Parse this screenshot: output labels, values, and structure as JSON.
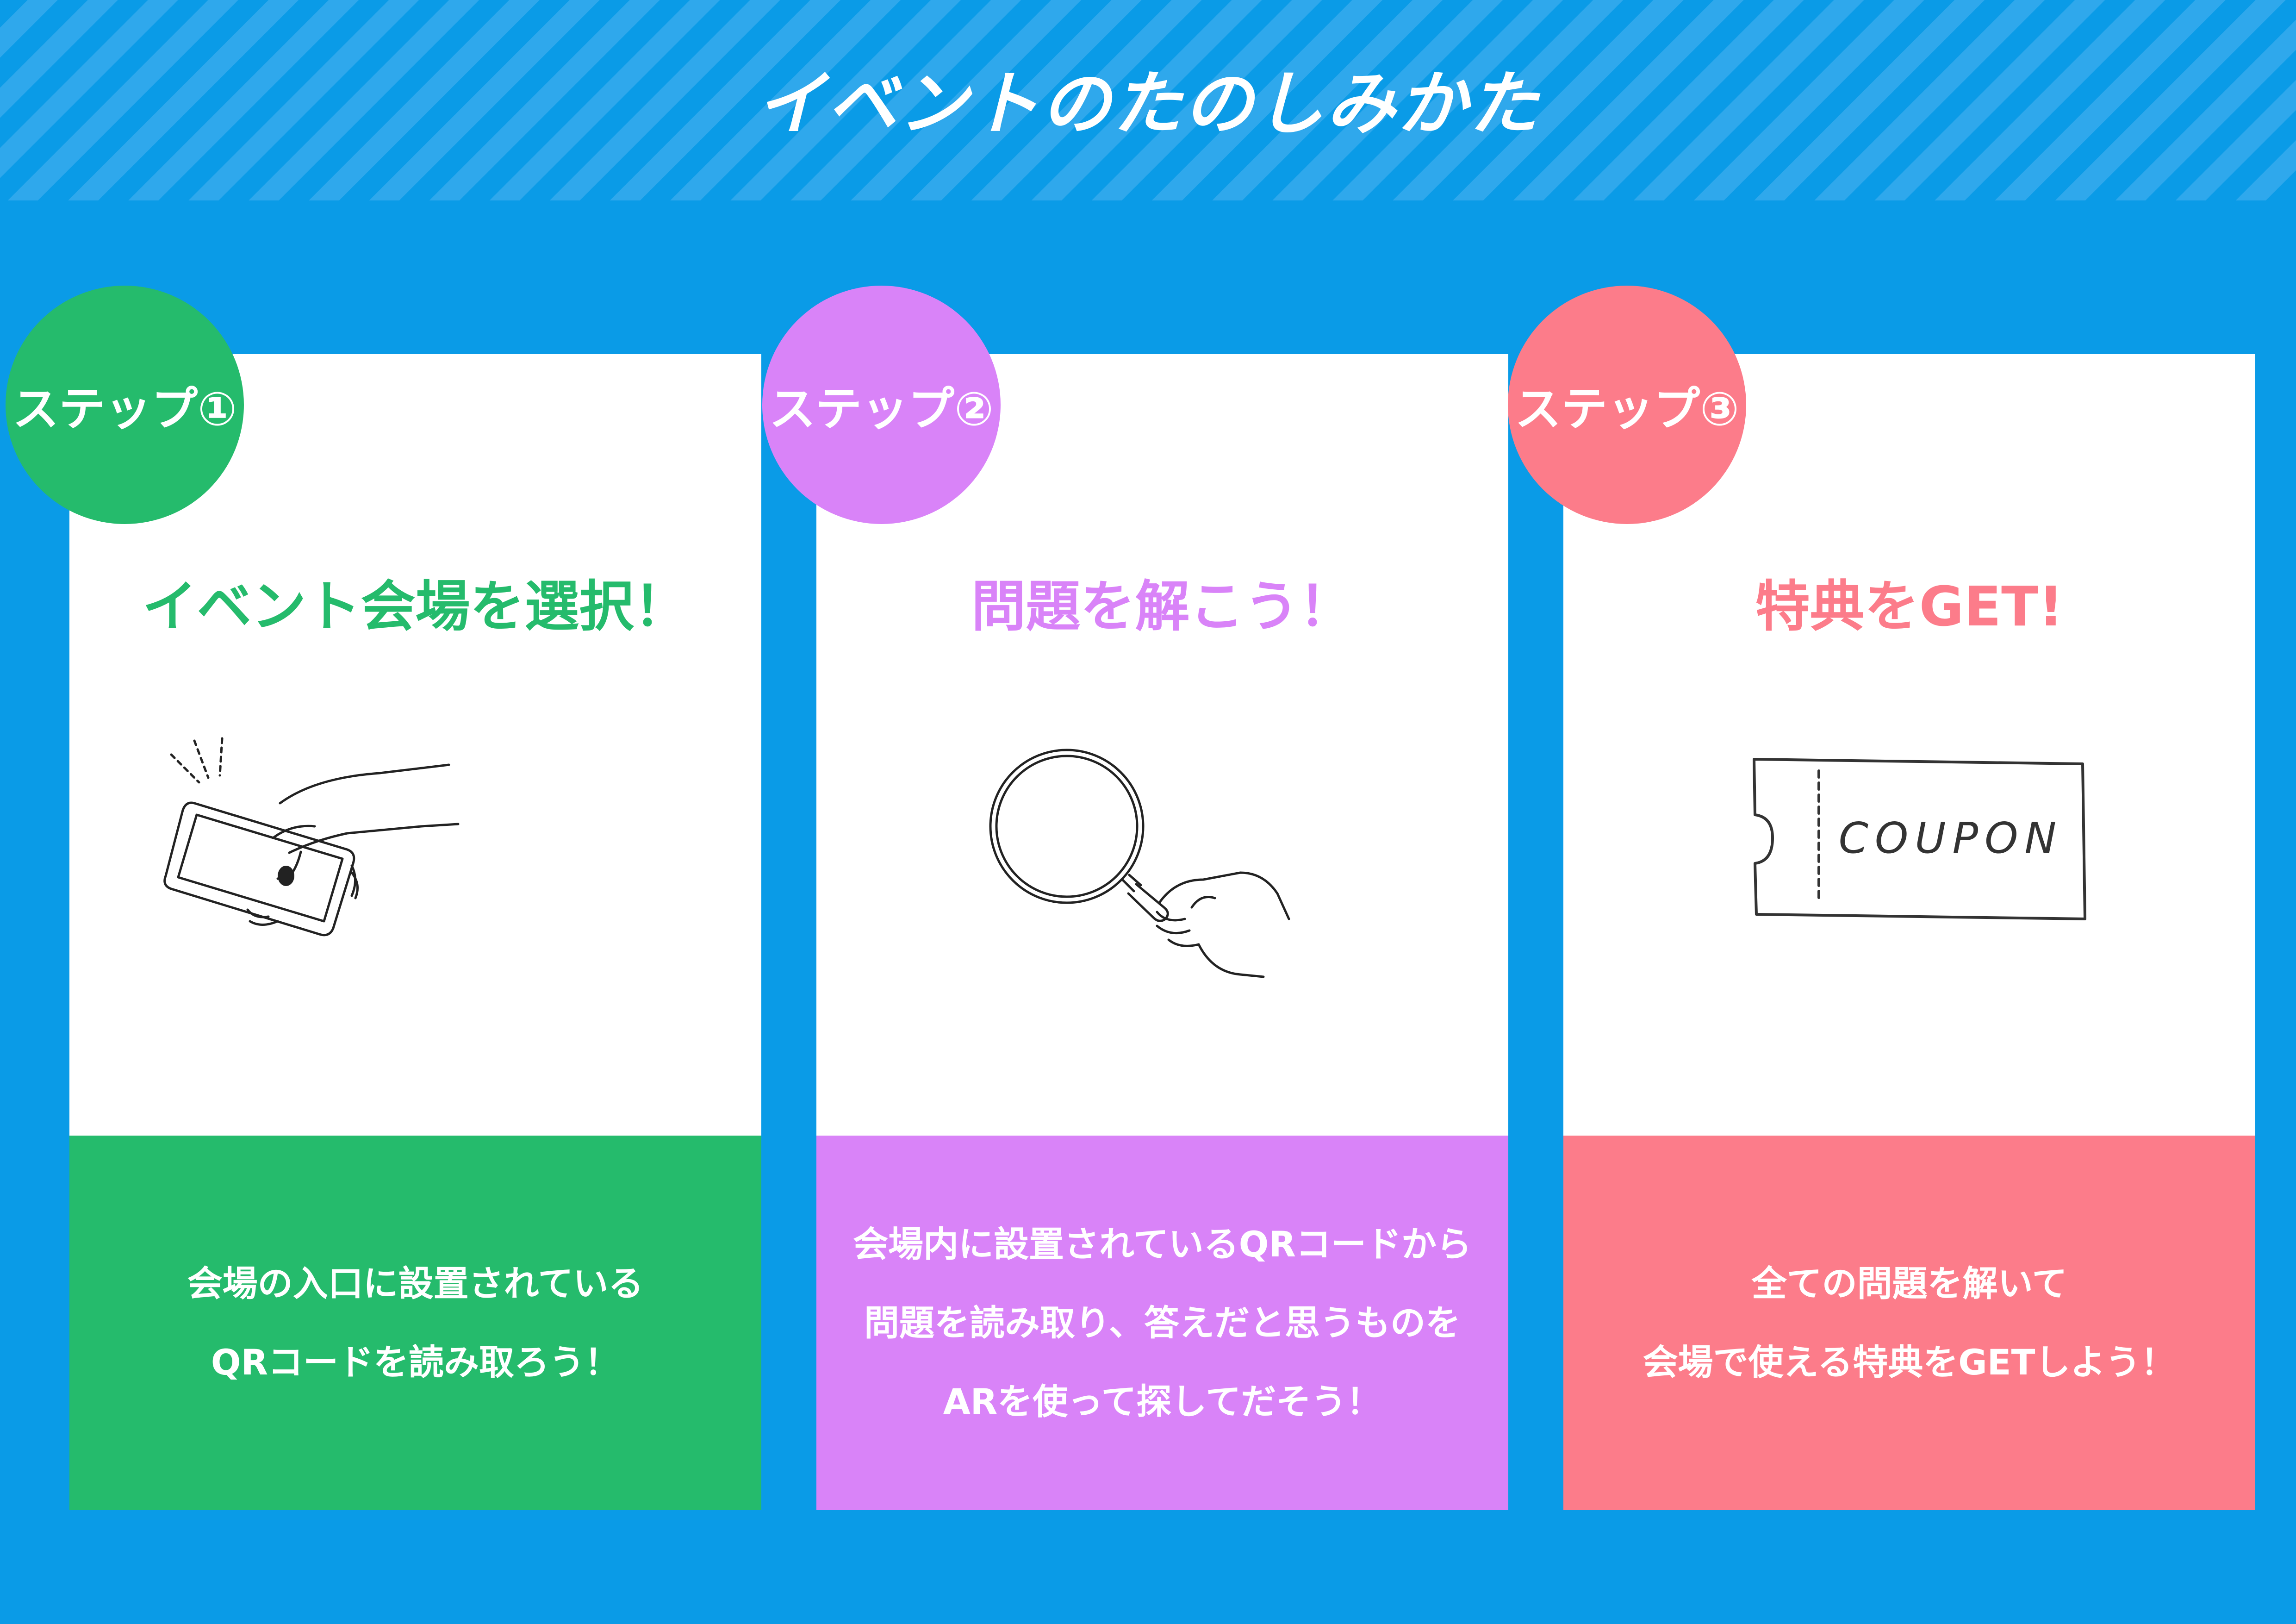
{
  "title": "イベントのたのしみかた",
  "colors": {
    "background": "#0a9be7",
    "step1": "#25bb6c",
    "step2": "#d983f8",
    "step3": "#fc7c8a"
  },
  "steps": [
    {
      "badge": "ステップ①",
      "heading": "イベント会場を選択！",
      "illustration": "smartphone-hand-icon",
      "lines": [
        "会場の入口に設置されている",
        "QRコードを読み取ろう！"
      ]
    },
    {
      "badge": "ステップ②",
      "heading": "問題を解こう！",
      "illustration": "magnifying-glass-icon",
      "lines": [
        "会場内に設置されているQRコードから",
        "問題を読み取り、答えだと思うものを",
        "ARを使って探してだそう！"
      ]
    },
    {
      "badge": "ステップ③",
      "heading": "特典をGET!",
      "illustration": "coupon-ticket-icon",
      "coupon_label": "COUPON",
      "lines": [
        "全ての問題を解いて",
        "会場で使える特典をGETしよう！"
      ]
    }
  ]
}
